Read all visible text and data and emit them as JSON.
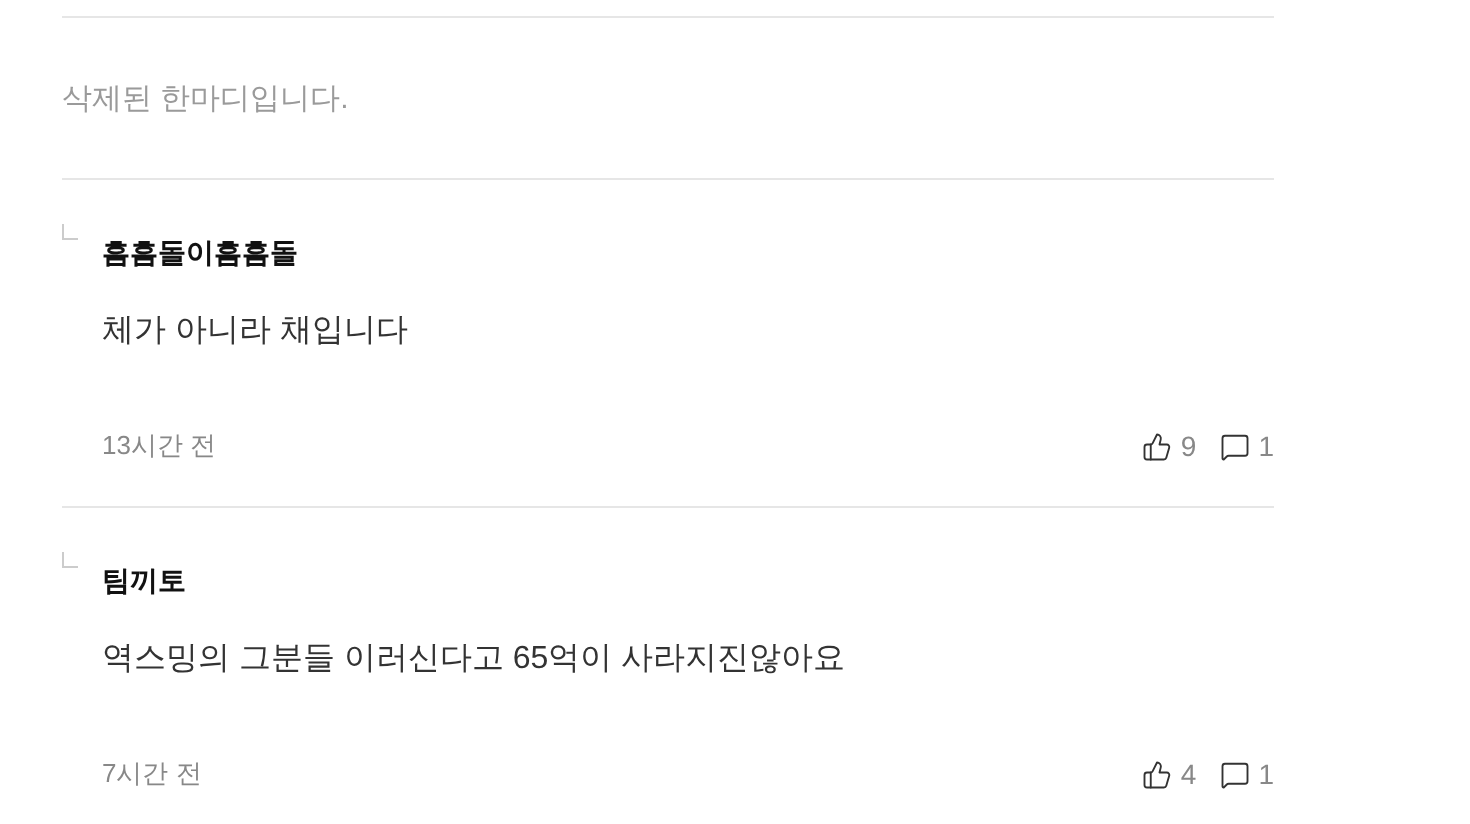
{
  "deleted_comment": {
    "text": "삭제된 한마디입니다."
  },
  "replies": [
    {
      "author": "흠흠돌이흠흠돌",
      "body": "체가 아니라 채입니다",
      "time": "13시간 전",
      "likes": "9",
      "replies": "1"
    },
    {
      "author": "팀끼토",
      "body": "역스밍의 그분들 이러신다고 65억이 사라지진않아요",
      "time": "7시간 전",
      "likes": "4",
      "replies": "1"
    }
  ]
}
